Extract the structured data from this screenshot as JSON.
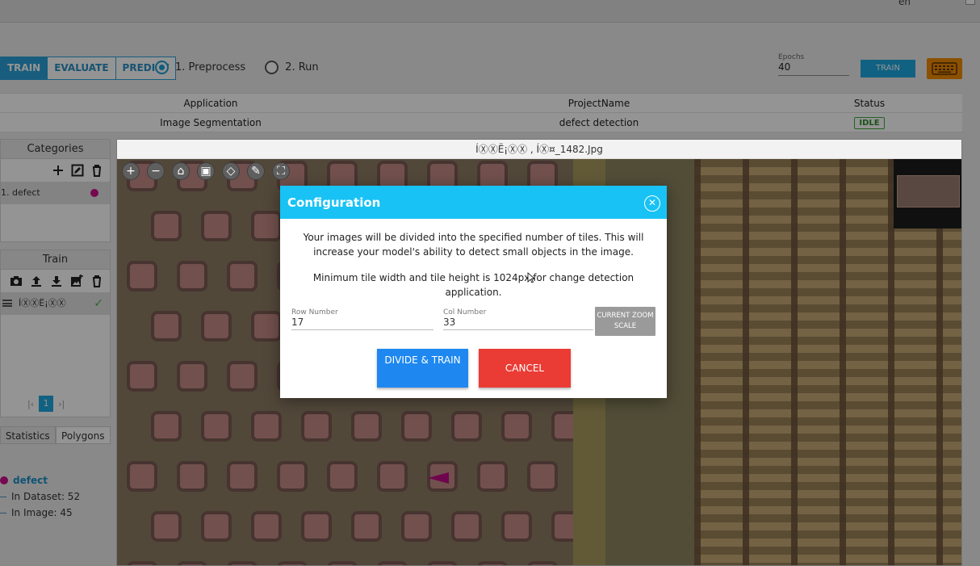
{
  "topbar": {
    "lang": "en"
  },
  "modes": [
    "TRAIN",
    "EVALUATE",
    "PREDICT"
  ],
  "steps": [
    "1. Preprocess",
    "2. Run"
  ],
  "epochs": {
    "label": "Epochs",
    "value": "40"
  },
  "train_button": "TRAIN",
  "table": {
    "headers": [
      "Application",
      "ProjectName",
      "Status"
    ],
    "row": [
      "Image Segmentation",
      "defect detection",
      "IDLE"
    ]
  },
  "categories": {
    "title": "Categories",
    "items": [
      {
        "label": "1. defect",
        "color": "#cc0f8b"
      }
    ]
  },
  "train_panel": {
    "title": "Train",
    "item_label": "ÍⓍⓍË¡ⓍⓍ",
    "page": "1"
  },
  "tabs": [
    "Statistics",
    "Polygons"
  ],
  "stats": {
    "name": "defect",
    "dataset": "In Dataset: 52",
    "image": "In Image: 45"
  },
  "viewer": {
    "filename": "ÍⓍⓍË¡ⓍⓍ , ÍⓍ¤_1482.Jpg"
  },
  "dialog": {
    "title": "Configuration",
    "message1": "Your images will be divided into the specified number of tiles. This will increase your model's ability to detect small objects in the image.",
    "message2": "Minimum tile width and tile height is 1024px for change detection application.",
    "row_label": "Row Number",
    "row_value": "17",
    "col_label": "Col Number",
    "col_value": "33",
    "zoom_button": "CURRENT ZOOM SCALE",
    "divide_button": "DIVIDE & TRAIN",
    "cancel_button": "CANCEL"
  },
  "colors": {
    "accent": "#18c2f5",
    "primary": "#1e88f0",
    "danger": "#ea3c35",
    "keyboard": "#f08a00",
    "defect": "#cc0f8b"
  }
}
